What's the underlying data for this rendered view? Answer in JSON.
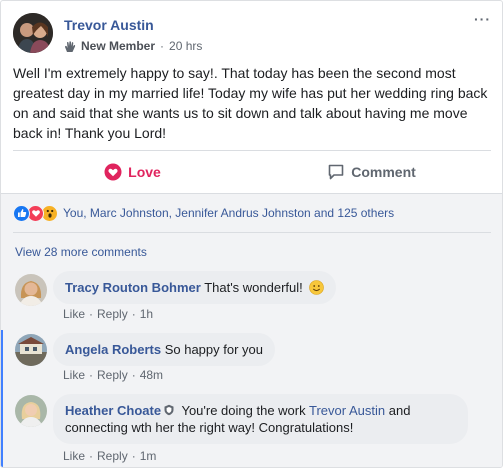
{
  "post": {
    "author": "Trevor Austin",
    "badge": "New Member",
    "separator": "·",
    "time": "20 hrs",
    "more_label": "···",
    "text": "Well I'm extremely happy to say!. That today has been the second most greatest day in my married life! Today my wife has put her wedding ring back on and said that she wants us to sit down and talk about having me move back in! Thank you Lord!"
  },
  "actions": {
    "love": "Love",
    "comment": "Comment"
  },
  "reactions": {
    "summary": "You, Marc Johnston, Jennifer Andrus Johnston and 125 others",
    "icons": [
      "like-icon",
      "love-icon",
      "wow-icon"
    ]
  },
  "view_more": "View 28 more comments",
  "comments": [
    {
      "author": "Tracy Routon Bohmer",
      "text": "That's wonderful!",
      "like": "Like",
      "reply": "Reply",
      "time": "1h",
      "dot": "·"
    },
    {
      "author": "Angela Roberts",
      "text": "So happy for you",
      "like": "Like",
      "reply": "Reply",
      "time": "48m",
      "dot": "·"
    },
    {
      "author": "Heather Choate",
      "text_before": "You're doing the work",
      "mention": "Trevor Austin",
      "text_after": "and connecting wth her the right way! Congratulations!",
      "like": "Like",
      "reply": "Reply",
      "time": "1m",
      "dot": "·"
    }
  ],
  "colors": {
    "link": "#385898",
    "love": "#e0245e",
    "thread": "#4080ff"
  }
}
